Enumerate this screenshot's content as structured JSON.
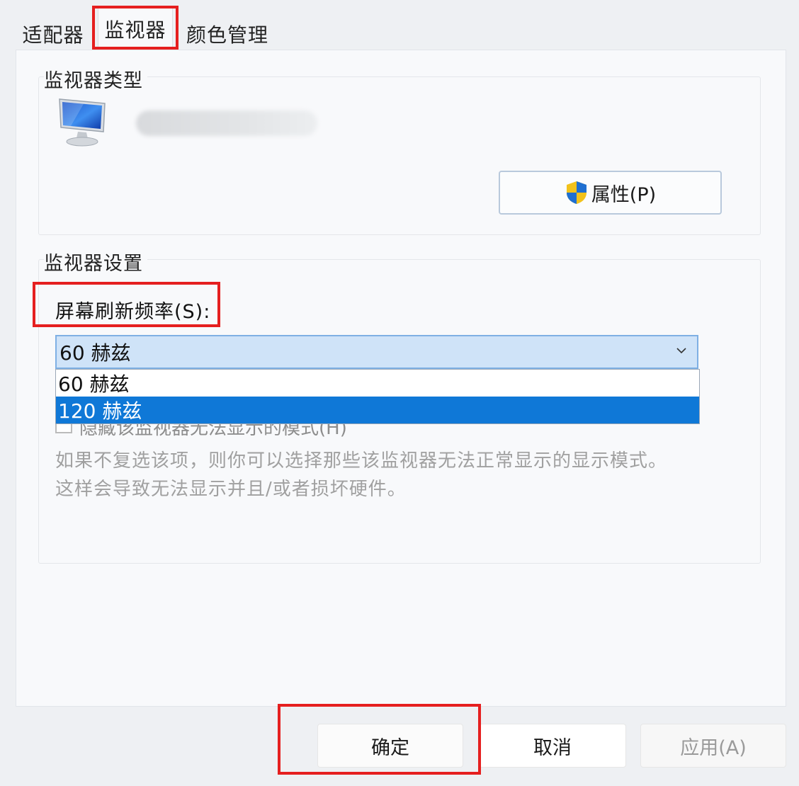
{
  "tabs": {
    "adapter": "适配器",
    "monitor": "监视器",
    "color": "颜色管理"
  },
  "monitor_type": {
    "title": "监视器类型",
    "properties_button": "属性(P)"
  },
  "monitor_settings": {
    "title": "监视器设置",
    "refresh_label": "屏幕刷新频率(S):",
    "refresh_value": "60 赫兹",
    "refresh_options": [
      "60 赫兹",
      "120 赫兹"
    ],
    "hide_modes_label": "隐藏该监视器无法显示的模式(H)",
    "hint_line1": "如果不复选该项，则你可以选择那些该监视器无法正常显示的显示模式。",
    "hint_line2": "这样会导致无法显示并且/或者损坏硬件。"
  },
  "buttons": {
    "ok": "确定",
    "cancel": "取消",
    "apply": "应用(A)"
  },
  "colors": {
    "highlight": "#e51f1f",
    "selected_option": "#0f78d7",
    "combo_background": "#cfe3f8"
  },
  "icons": {
    "monitor": "monitor-icon",
    "shield": "uac-shield-icon",
    "dropdown": "chevron-down-icon"
  }
}
